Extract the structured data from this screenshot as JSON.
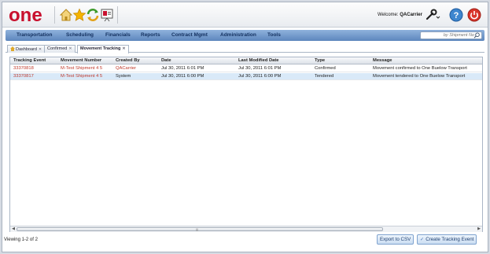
{
  "header": {
    "logo_text": "one",
    "welcome_prefix": "Welcome: ",
    "user_name": "QACarrier"
  },
  "nav": {
    "items": [
      "Transportation",
      "Scheduling",
      "Financials",
      "Reports",
      "Contract Mgmt",
      "Administration",
      "Tools"
    ],
    "search_placeholder": "by Shipment No"
  },
  "tabs": [
    {
      "label": "Dashboard"
    },
    {
      "label": "Confirmed"
    },
    {
      "label": "Movement Tracking"
    }
  ],
  "grid": {
    "columns": [
      "Tracking Event",
      "Movement Number",
      "Created By",
      "Date",
      "Last Modified Date",
      "Type",
      "Message"
    ],
    "rows": [
      [
        "33370818",
        "M-Test Shipment 4 5",
        "QACarrier",
        "Jul 30, 2011 6:01 PM",
        "Jul 30, 2011 6:01 PM",
        "Confirmed",
        "Movement confirmed to One Buelow Transport"
      ],
      [
        "33370817",
        "M-Test Shipment 4 5",
        "System",
        "Jul 30, 2011 6:00 PM",
        "Jul 30, 2011 6:00 PM",
        "Tendered",
        "Movement tendered to One Buelow Transport"
      ]
    ]
  },
  "footer": {
    "viewing": "Viewing 1-2 of 2",
    "export_label": "Export to CSV",
    "create_label": "Create Tracking Event"
  },
  "colors": {
    "brand_red": "#c8102e",
    "nav_blue": "#6d93c6",
    "link_red": "#c0392b",
    "selected_row": "#d9e9f8"
  }
}
